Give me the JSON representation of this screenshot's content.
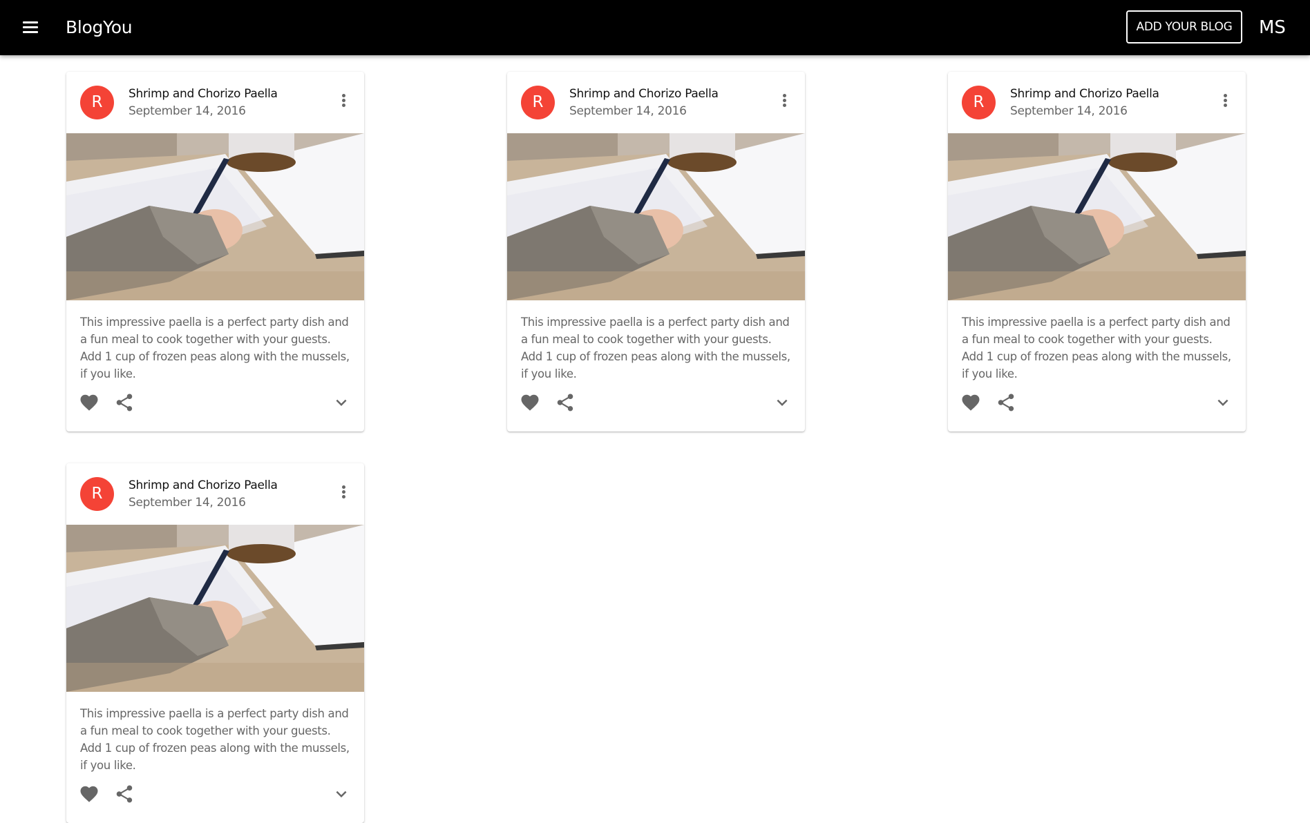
{
  "app": {
    "title": "BlogYou",
    "add_blog_label": "ADD YOUR BLOG",
    "user_initials": "MS",
    "icons": {
      "menu": "hamburger-menu-icon"
    }
  },
  "colors": {
    "appbar": "#000000",
    "avatar": "#f44336",
    "icon": "#666666"
  },
  "posts": [
    {
      "avatar": "R",
      "title": "Shrimp and Chorizo Paella",
      "date": "September 14, 2016",
      "text": "This impressive paella is a perfect party dish and a fun meal to cook together with your guests. Add 1 cup of frozen peas along with the mussels, if you like.",
      "image": "person writing in notebook with pen, coffee cup on table"
    },
    {
      "avatar": "R",
      "title": "Shrimp and Chorizo Paella",
      "date": "September 14, 2016",
      "text": "This impressive paella is a perfect party dish and a fun meal to cook together with your guests. Add 1 cup of frozen peas along with the mussels, if you like.",
      "image": "person writing in notebook with pen, coffee cup on table"
    },
    {
      "avatar": "R",
      "title": "Shrimp and Chorizo Paella",
      "date": "September 14, 2016",
      "text": "This impressive paella is a perfect party dish and a fun meal to cook together with your guests. Add 1 cup of frozen peas along with the mussels, if you like.",
      "image": "person writing in notebook with pen, coffee cup on table"
    },
    {
      "avatar": "R",
      "title": "Shrimp and Chorizo Paella",
      "date": "September 14, 2016",
      "text": "This impressive paella is a perfect party dish and a fun meal to cook together with your guests. Add 1 cup of frozen peas along with the mussels, if you like.",
      "image": "person writing in notebook with pen, coffee cup on table"
    }
  ]
}
